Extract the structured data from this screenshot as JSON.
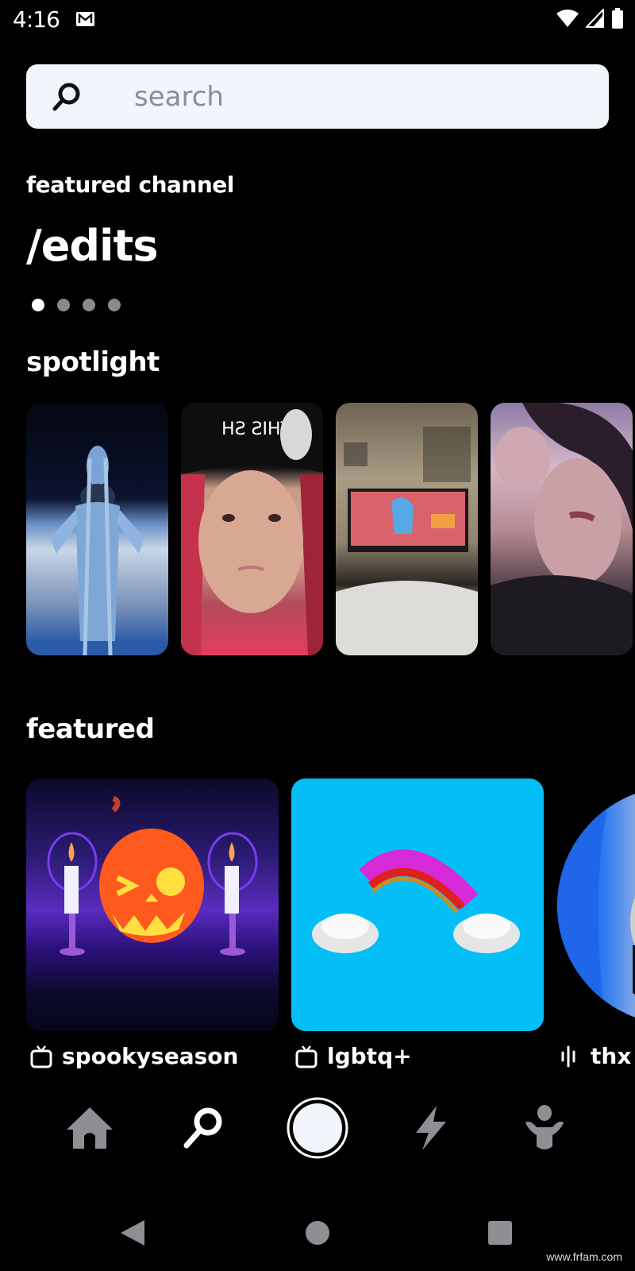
{
  "status_bar": {
    "time": "4:16",
    "notification_icon": "gmail-icon",
    "right_icons": [
      "wifi-icon",
      "cellular-signal-icon",
      "battery-icon"
    ]
  },
  "search": {
    "placeholder": "search",
    "value": "",
    "icon": "search-icon"
  },
  "featured_channel": {
    "label": "featured channel",
    "title": "/edits",
    "pager": {
      "count": 4,
      "active_index": 0
    }
  },
  "spotlight": {
    "title": "spotlight",
    "items": [
      {
        "description": "blue alien diva singing in space"
      },
      {
        "description": "person with red hair and black beanie"
      },
      {
        "description": "TV in bedroom showing cartoon pony"
      },
      {
        "description": "person with dark hair covering face"
      }
    ]
  },
  "featured": {
    "title": "featured",
    "items": [
      {
        "label": "spookyseason",
        "icon": "tv-icon",
        "description": "winking jack-o-lantern between candles"
      },
      {
        "label": "lgbtq+",
        "icon": "tv-icon",
        "description": "rainbow between two clouds on blue"
      },
      {
        "label": "thx",
        "icon": "audio-waveform-icon",
        "description": "person with blue hair"
      }
    ]
  },
  "bottom_nav": {
    "items": [
      {
        "name": "home",
        "icon": "home-icon",
        "active": false
      },
      {
        "name": "search",
        "icon": "search-icon",
        "active": true
      },
      {
        "name": "record",
        "icon": "record-button-icon",
        "active": false
      },
      {
        "name": "activity",
        "icon": "lightning-icon",
        "active": false
      },
      {
        "name": "profile",
        "icon": "person-icon",
        "active": false
      }
    ]
  },
  "system_nav": {
    "items": [
      "back",
      "home",
      "recents"
    ]
  },
  "watermark": "www.frfam.com",
  "colors": {
    "background": "#000000",
    "search_bg": "#f3f5fd",
    "placeholder": "#8a8d95",
    "inactive_icon": "#8e8f94",
    "lgbtq_card": "#03bff6"
  }
}
